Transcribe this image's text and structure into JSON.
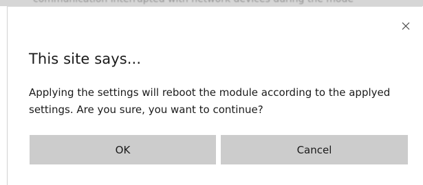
{
  "backdrop": {
    "text": "communication interrupted with network devices during the mode"
  },
  "dialog": {
    "title": "This site says...",
    "message": "Applying the settings will reboot the module according to the applyed settings. Are you sure, you want to continue?",
    "close_icon": "close-icon",
    "ok_label": "OK",
    "cancel_label": "Cancel"
  },
  "colors": {
    "button_bg": "#cccccc",
    "text": "#1a1a1a",
    "dialog_bg": "#ffffff"
  }
}
